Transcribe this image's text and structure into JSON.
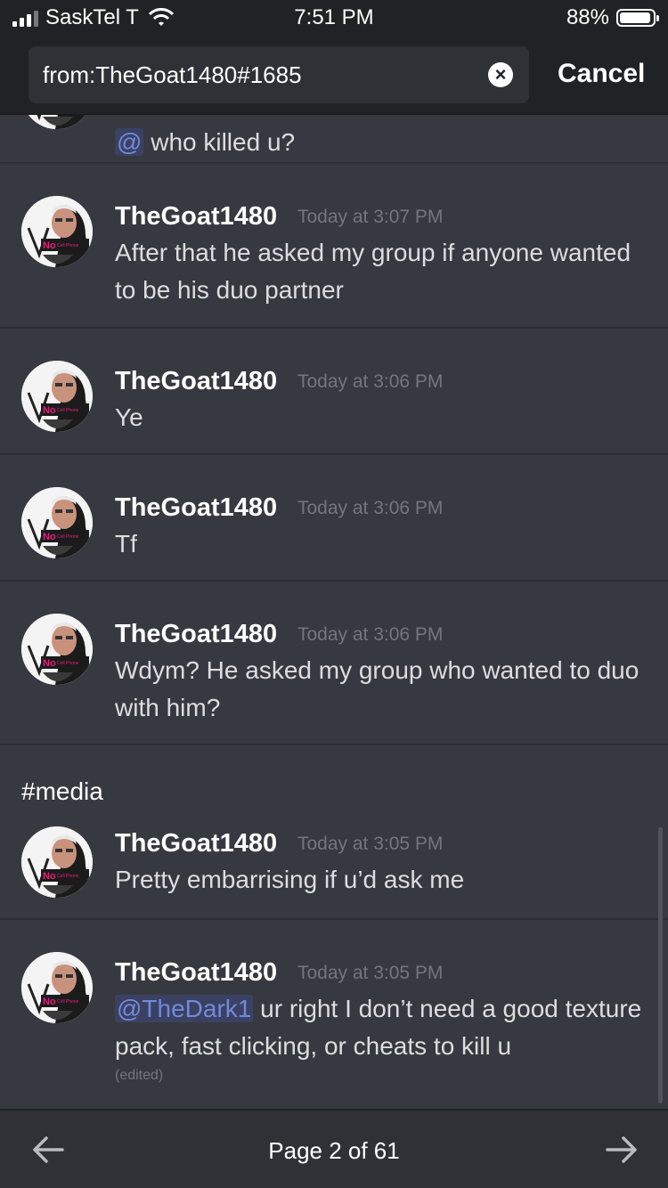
{
  "status_bar": {
    "carrier": "SaskTel T",
    "time": "7:51 PM",
    "battery": "88%"
  },
  "search": {
    "query": "from:TheGoat1480#1685",
    "cancel_label": "Cancel"
  },
  "messages": [
    {
      "mention": "@",
      "text": "who killed u?"
    },
    {
      "author": "TheGoat1480",
      "timestamp": "Today at 3:07 PM",
      "text": "After that he asked my group if anyone wanted to be his duo partner"
    },
    {
      "author": "TheGoat1480",
      "timestamp": "Today at 3:06 PM",
      "text": "Ye"
    },
    {
      "author": "TheGoat1480",
      "timestamp": "Today at 3:06 PM",
      "text": "Tf"
    },
    {
      "author": "TheGoat1480",
      "timestamp": "Today at 3:06 PM",
      "text": "Wdym? He asked my group who wanted to duo with him?"
    },
    {
      "author": "TheGoat1480",
      "timestamp": "Today at 3:05 PM",
      "text": "Pretty embarrising if u’d ask me"
    },
    {
      "author": "TheGoat1480",
      "timestamp": "Today at 3:05 PM",
      "mention": "@TheDark1",
      "text": "ur right I don’t need a good texture pack, fast clicking, or cheats  to kill u",
      "edited": "(edited)"
    }
  ],
  "channel_label": "#media",
  "avatar_badge": "No",
  "avatar_badge_small": "Cell Phone",
  "pagination": {
    "label": "Page 2 of 61"
  }
}
